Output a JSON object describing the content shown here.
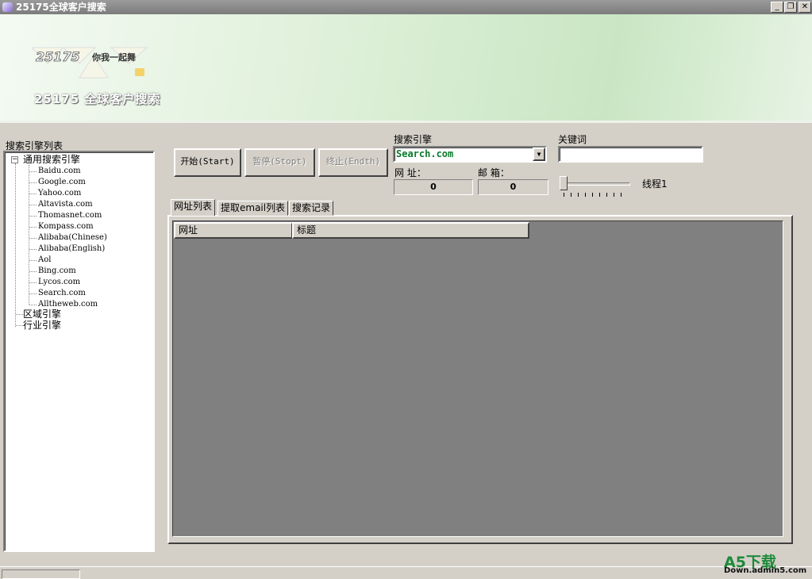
{
  "window": {
    "title": "25175全球客户搜索",
    "minimize": "_",
    "restore": "❐",
    "close": "✕"
  },
  "banner": {
    "slogan": "你我一起舞",
    "logo_text": "25175",
    "title": "25175 全球客户搜索"
  },
  "tree": {
    "label": "搜索引擎列表",
    "groups": [
      {
        "label": "通用搜索引擎",
        "expander": "−",
        "children": [
          "Baidu.com",
          "Google.com",
          "Yahoo.com",
          "Altavista.com",
          "Thomasnet.com",
          "Kompass.com",
          "Alibaba(Chinese)",
          "Alibaba(English)",
          "Aol",
          "Bing.com",
          "Lycos.com",
          "Search.com",
          "Alltheweb.com"
        ]
      },
      {
        "label": "区域引擎"
      },
      {
        "label": "行业引擎"
      }
    ]
  },
  "toolbar": {
    "start": "开始(Start)",
    "pause": "暂停(Stopt)",
    "end": "终止(Endth)"
  },
  "engine": {
    "label": "搜索引擎",
    "value": "Search.com",
    "arrow": "▼"
  },
  "stats": {
    "url_label": "网 址：",
    "url_count": "0",
    "email_label": "邮 箱：",
    "email_count": "0"
  },
  "keyword": {
    "label": "关键词",
    "value": ""
  },
  "threads": {
    "label": "线程1",
    "value": 1,
    "min": 1,
    "max": 10
  },
  "tabs": [
    "网址列表",
    "提取email列表",
    "搜索记录"
  ],
  "grid": {
    "columns": [
      "网址",
      "标题"
    ]
  },
  "watermark": {
    "main": "A5下载",
    "sub": "Down.admin5.com"
  },
  "colors": {
    "engine_text": "#0a7a2a",
    "grid_bg": "#808080",
    "watermark": "#1e8a3a"
  }
}
